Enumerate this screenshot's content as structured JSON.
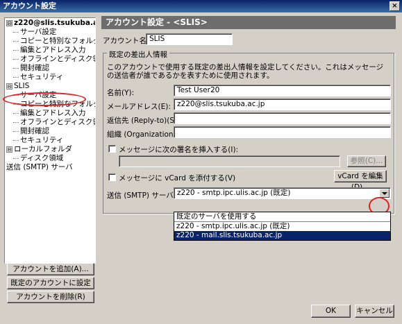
{
  "window": {
    "title": "アカウント設定",
    "close_glyph": "×"
  },
  "tree": {
    "items": [
      {
        "label": "z220@slis.tsukuba.ac.jp",
        "level": 0,
        "expander": "⊟",
        "bold": true
      },
      {
        "label": "サーバ設定",
        "level": 1
      },
      {
        "label": "コピーと特別なフォルダ",
        "level": 1
      },
      {
        "label": "編集とアドレス入力",
        "level": 1
      },
      {
        "label": "オフラインとディスク領域",
        "level": 1
      },
      {
        "label": "開封確認",
        "level": 1
      },
      {
        "label": "セキュリティ",
        "level": 1
      },
      {
        "label": "SLIS",
        "level": 0,
        "expander": "⊟"
      },
      {
        "label": "サーバ設定",
        "level": 1
      },
      {
        "label": "コピーと特別なフォルダ",
        "level": 1
      },
      {
        "label": "編集とアドレス入力",
        "level": 1
      },
      {
        "label": "オフラインとディスク領域",
        "level": 1
      },
      {
        "label": "開封確認",
        "level": 1
      },
      {
        "label": "セキュリティ",
        "level": 1
      },
      {
        "label": "ローカルフォルダ",
        "level": 0,
        "expander": "⊟"
      },
      {
        "label": "ディスク領域",
        "level": 1
      },
      {
        "label": "送信 (SMTP) サーバ",
        "level": 0
      }
    ]
  },
  "left_buttons": {
    "add_account": "アカウントを追加(A)...",
    "set_default": "既定のアカウントに設定(F)",
    "delete_account": "アカウントを削除(R)"
  },
  "panel": {
    "header": "アカウント設定 - <SLIS>",
    "account_name_label": "アカウント名(N):",
    "account_name_value": "SLIS",
    "identity_group_title": "既定の差出人情報",
    "identity_desc": "このアカウントで使用する既定の差出人情報を設定してください。これはメッセージの送信者が誰であるかを表すために使用されます。",
    "name_label": "名前(Y):",
    "name_value": "Test User20",
    "email_label": "メールアドレス(E):",
    "email_value": "z220@slis.tsukuba.ac.jp",
    "replyto_label": "返信先 (Reply-to)(S):",
    "replyto_value": "",
    "org_label": "組織 (Organization)(O):",
    "org_value": "",
    "signature_label": "メッセージに次の署名を挿入する(I):",
    "signature_value": "",
    "browse_label": "参照(C)...",
    "vcard_label": "メッセージに vCard を添付する(V)",
    "vcard_edit_label": "vCard を編集(D)...",
    "smtp_label": "送信 (SMTP) サーバ(U):",
    "smtp_selected": "z220 - smtp.ipc.ulis.ac.jp (既定)",
    "smtp_options": [
      "既定のサーバを使用する",
      "z220 - smtp.ipc.ulis.ac.jp (既定)",
      "z220 - mail.slis.tsukuba.ac.jp"
    ]
  },
  "footer": {
    "ok_label": "OK",
    "cancel_label": "キャンセル"
  }
}
